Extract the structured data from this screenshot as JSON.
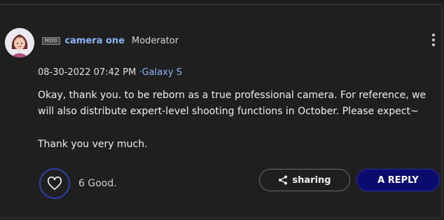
{
  "post": {
    "badge": "MOD",
    "author": "camera one",
    "role": "Moderator",
    "date": "08-30-2022 07:42 PM",
    "separator": "·",
    "device": "Galaxy S",
    "body_line1": "Okay, thank you. to be reborn as a true professional camera. For reference, we will also distribute expert-level shooting functions in October. Please expect~",
    "body_line2": "Thank you very much."
  },
  "actions": {
    "likes": "6 Good.",
    "share_label": "sharing",
    "reply_label": "A REPLY"
  },
  "colors": {
    "accent": "#8ab4f8",
    "reply_bg": "#0b0b6e",
    "like_ring": "#2f3fb2"
  },
  "icons": [
    "avatar-illustration",
    "more-options-icon",
    "heart-icon",
    "share-icon"
  ]
}
